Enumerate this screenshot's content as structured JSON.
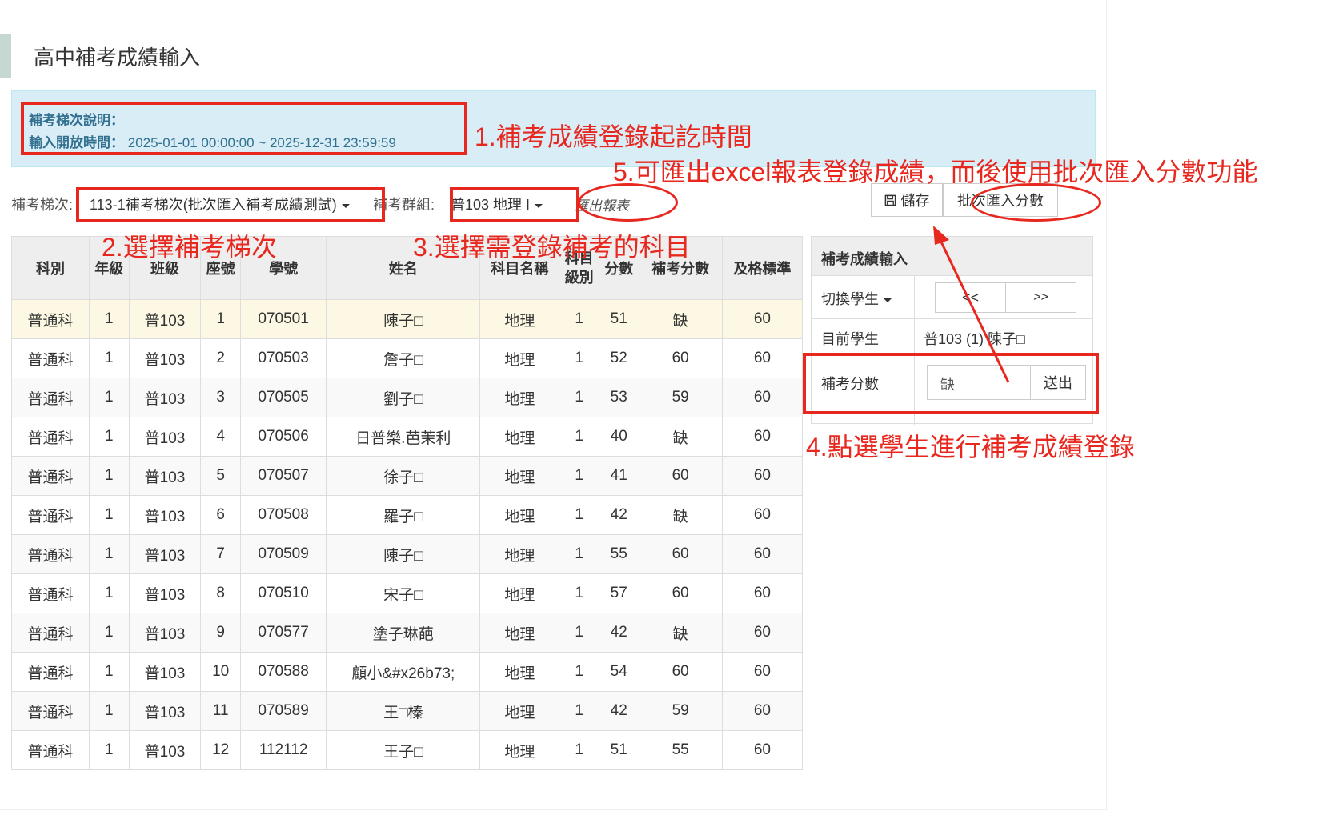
{
  "page": {
    "title": "高中補考成績輸入"
  },
  "info": {
    "heading": "補考梯次說明：",
    "open_time_label": "輸入開放時間：",
    "open_time_value": "2025-01-01 00:00:00 ~ 2025-12-31 23:59:59"
  },
  "filters": {
    "batch_label": "補考梯次:",
    "batch_value": "113-1補考梯次(批次匯入補考成績測試)",
    "group_label": "補考群組:",
    "group_value": "普103 地理 I",
    "export_label": "匯出報表"
  },
  "toolbar": {
    "save_label": "儲存",
    "batch_import_label": "批次匯入分數"
  },
  "table": {
    "headers": [
      "科別",
      "年級",
      "班級",
      "座號",
      "學號",
      "姓名",
      "科目名稱",
      "科目\n級別",
      "分數",
      "補考分數",
      "及格標準"
    ],
    "rows": [
      [
        "普通科",
        "1",
        "普103",
        "1",
        "070501",
        "陳子□",
        "地理",
        "1",
        "51",
        "缺",
        "60"
      ],
      [
        "普通科",
        "1",
        "普103",
        "2",
        "070503",
        "詹子□",
        "地理",
        "1",
        "52",
        "60",
        "60"
      ],
      [
        "普通科",
        "1",
        "普103",
        "3",
        "070505",
        "劉子□",
        "地理",
        "1",
        "53",
        "59",
        "60"
      ],
      [
        "普通科",
        "1",
        "普103",
        "4",
        "070506",
        "日普樂.芭茉利",
        "地理",
        "1",
        "40",
        "缺",
        "60"
      ],
      [
        "普通科",
        "1",
        "普103",
        "5",
        "070507",
        "徐子□",
        "地理",
        "1",
        "41",
        "60",
        "60"
      ],
      [
        "普通科",
        "1",
        "普103",
        "6",
        "070508",
        "羅子□",
        "地理",
        "1",
        "42",
        "缺",
        "60"
      ],
      [
        "普通科",
        "1",
        "普103",
        "7",
        "070509",
        "陳子□",
        "地理",
        "1",
        "55",
        "60",
        "60"
      ],
      [
        "普通科",
        "1",
        "普103",
        "8",
        "070510",
        "宋子□",
        "地理",
        "1",
        "57",
        "60",
        "60"
      ],
      [
        "普通科",
        "1",
        "普103",
        "9",
        "070577",
        "塗子琳葩",
        "地理",
        "1",
        "42",
        "缺",
        "60"
      ],
      [
        "普通科",
        "1",
        "普103",
        "10",
        "070588",
        "顧小&#x26b73;",
        "地理",
        "1",
        "54",
        "60",
        "60"
      ],
      [
        "普通科",
        "1",
        "普103",
        "11",
        "070589",
        "王□榛",
        "地理",
        "1",
        "42",
        "59",
        "60"
      ],
      [
        "普通科",
        "1",
        "普103",
        "12",
        "112112",
        "王子□",
        "地理",
        "1",
        "51",
        "55",
        "60"
      ]
    ]
  },
  "side_panel": {
    "title": "補考成績輸入",
    "switch_label": "切換學生",
    "prev_label": "<<",
    "next_label": ">>",
    "current_label": "目前學生",
    "current_value": "普103 (1) 陳子□",
    "score_label": "補考分數",
    "score_value": "缺",
    "submit_label": "送出"
  },
  "annotations": {
    "a1": "1.補考成績登錄起訖時間",
    "a2": "2.選擇補考梯次",
    "a3": "3.選擇需登錄補考的科目",
    "a4": "4.點選學生進行補考成績登錄",
    "a5": "5.可匯出excel報表登錄成績，而後使用批次匯入分數功能"
  },
  "colors": {
    "annotation": "#e8271e",
    "info_bg": "#d9edf7",
    "info_text": "#31708f",
    "active_row": "#fcf8e3"
  }
}
